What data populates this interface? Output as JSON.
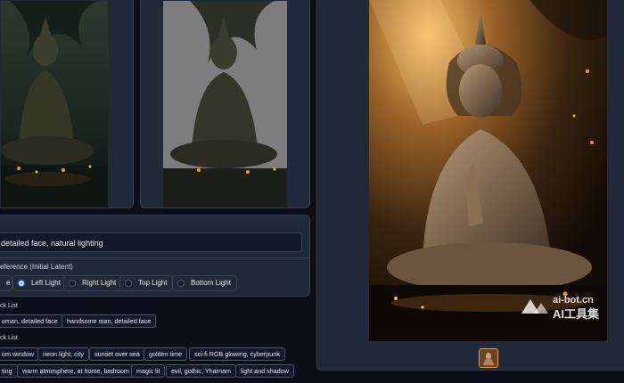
{
  "prompt": {
    "value": "detailed face, natural lighting"
  },
  "lighting": {
    "label": "eference (Initial Latent)",
    "options": [
      {
        "label": "e",
        "selected": false
      },
      {
        "label": "Left Light",
        "selected": true
      },
      {
        "label": "Right Light",
        "selected": false
      },
      {
        "label": "Top Light",
        "selected": false
      },
      {
        "label": "Bottom Light",
        "selected": false
      }
    ]
  },
  "subject_list": {
    "label": "ck List",
    "items": [
      "oman, detailed face",
      "handsome man, detailed face"
    ]
  },
  "lighting_list": {
    "label": "ck List",
    "row1": [
      "om window",
      "neon light, city",
      "sunset over sea",
      "golden time",
      "sci-fi RGB glowing, cyberpunk"
    ],
    "row2": [
      "ting",
      "warm atmosphere, at home, bedroom",
      "magic lit",
      "evil, gothic, Yharnam",
      "light and shadow"
    ]
  },
  "watermark": {
    "line1": "ai-bot.cn",
    "line2": "AI工具集"
  },
  "colors": {
    "accent": "#2563eb",
    "panel": "#1f2937",
    "background": "#0b0f19"
  }
}
